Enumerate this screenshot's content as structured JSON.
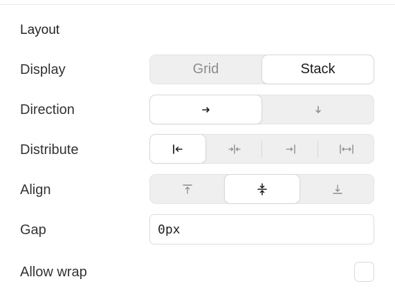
{
  "section": {
    "title": "Layout"
  },
  "rows": {
    "display": {
      "label": "Display",
      "options": [
        "Grid",
        "Stack"
      ],
      "selected": "Stack"
    },
    "direction": {
      "label": "Direction",
      "options": [
        "horizontal-arrow-icon",
        "vertical-arrow-icon"
      ],
      "selected": "horizontal-arrow-icon"
    },
    "distribute": {
      "label": "Distribute",
      "options": [
        "distribute-start-icon",
        "distribute-center-icon",
        "distribute-end-icon",
        "distribute-space-between-icon"
      ],
      "selected": "distribute-start-icon"
    },
    "align": {
      "label": "Align",
      "options": [
        "align-top-icon",
        "align-center-icon",
        "align-bottom-icon"
      ],
      "selected": "align-center-icon"
    },
    "gap": {
      "label": "Gap",
      "value": "0px"
    },
    "wrap": {
      "label": "Allow wrap",
      "checked": false
    }
  },
  "colors": {
    "segment_bg": "#efefef",
    "segment_active_bg": "#ffffff",
    "icon_active": "#1a1a1a",
    "icon_inactive": "#8c8c8c"
  }
}
